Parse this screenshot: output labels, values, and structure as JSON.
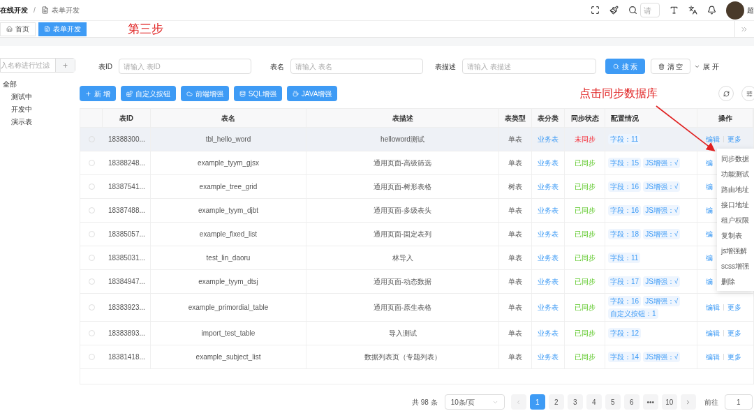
{
  "breadcrumb": [
    {
      "label": "在线开发"
    },
    {
      "label": "表单开发"
    }
  ],
  "breadcrumb_separator": "/",
  "header": {
    "search_placeholder": "请",
    "user_name": "超"
  },
  "tabs": [
    {
      "label": "首页",
      "selected": false
    },
    {
      "label": "表单开发",
      "selected": true
    }
  ],
  "annotations": {
    "step": "第三步",
    "hint": "点击同步数据库"
  },
  "sidebar": {
    "filter_placeholder": "入名称进行过滤",
    "add": "+",
    "tree": [
      {
        "label": "全部",
        "children": [
          {
            "label": "测试中"
          },
          {
            "label": "开发中"
          },
          {
            "label": "演示表"
          }
        ]
      }
    ]
  },
  "filters": [
    {
      "label": "表ID",
      "placeholder": "请输入 表ID"
    },
    {
      "label": "表名",
      "placeholder": "请输入 表名"
    },
    {
      "label": "表描述",
      "placeholder": "请输入 表描述"
    }
  ],
  "search_button": "搜 索",
  "clear_button": "清 空",
  "expand_link": "展 开",
  "toolbar": [
    {
      "label": "新 增"
    },
    {
      "label": "自定义按钮"
    },
    {
      "label": "前端增强"
    },
    {
      "label": "SQL增强"
    },
    {
      "label": "JAVA增强"
    }
  ],
  "table": {
    "columns": [
      "表ID",
      "表名",
      "表描述",
      "表类型",
      "表分类",
      "同步状态",
      "配置情况",
      "操作"
    ],
    "rows": [
      {
        "selected": false,
        "hover": true,
        "id": "18388300...",
        "name": "tbl_hello_word",
        "desc": "helloword测试",
        "type": "单表",
        "category": "业务表",
        "sync": "未同步",
        "synced": false,
        "tags": [
          "字段：11"
        ],
        "edit": "编辑",
        "more": "更多"
      },
      {
        "selected": false,
        "hover": false,
        "id": "18388248...",
        "name": "example_tyym_gjsx",
        "desc": "通用页面-高级筛选",
        "type": "单表",
        "category": "业务表",
        "sync": "已同步",
        "synced": true,
        "tags": [
          "字段：15",
          "JS增强：√"
        ],
        "edit": "编"
      },
      {
        "selected": false,
        "hover": false,
        "id": "18387541...",
        "name": "example_tree_grid",
        "desc": "通用页面-树形表格",
        "type": "树表",
        "category": "业务表",
        "sync": "已同步",
        "synced": true,
        "tags": [
          "字段：16",
          "JS增强：√"
        ],
        "edit": "编"
      },
      {
        "selected": false,
        "hover": false,
        "id": "18387488...",
        "name": "example_tyym_djbt",
        "desc": "通用页面-多级表头",
        "type": "单表",
        "category": "业务表",
        "sync": "已同步",
        "synced": true,
        "tags": [
          "字段：16",
          "JS增强：√"
        ],
        "edit": "编"
      },
      {
        "selected": false,
        "hover": false,
        "id": "18385057...",
        "name": "example_fixed_list",
        "desc": "通用页面-固定表列",
        "type": "单表",
        "category": "业务表",
        "sync": "已同步",
        "synced": true,
        "tags": [
          "字段：18",
          "JS增强：√"
        ],
        "edit": "编"
      },
      {
        "selected": false,
        "hover": false,
        "id": "18385031...",
        "name": "test_lin_daoru",
        "desc": "林导入",
        "type": "单表",
        "category": "业务表",
        "sync": "已同步",
        "synced": true,
        "tags": [
          "字段：11"
        ],
        "edit": "编"
      },
      {
        "selected": false,
        "hover": false,
        "id": "18384947...",
        "name": "example_tyym_dtsj",
        "desc": "通用页面-动态数据",
        "type": "单表",
        "category": "业务表",
        "sync": "已同步",
        "synced": true,
        "tags": [
          "字段：17",
          "JS增强：√"
        ],
        "edit": "编"
      },
      {
        "selected": false,
        "hover": false,
        "id": "18383923...",
        "name": "example_primordial_table",
        "desc": "通用页面-原生表格",
        "type": "单表",
        "category": "业务表",
        "sync": "已同步",
        "synced": true,
        "tags": [
          "字段：16",
          "JS增强：√",
          "自定义按钮：1"
        ],
        "edit": "编辑",
        "more": "更多"
      },
      {
        "selected": false,
        "hover": false,
        "id": "18383893...",
        "name": "import_test_table",
        "desc": "导入测试",
        "type": "单表",
        "category": "业务表",
        "sync": "已同步",
        "synced": true,
        "tags": [
          "字段：12"
        ],
        "edit": "编辑",
        "more": "更多"
      },
      {
        "selected": false,
        "hover": false,
        "id": "18381418...",
        "name": "example_subject_list",
        "desc": "数据列表页（专题列表）",
        "type": "单表",
        "category": "业务表",
        "sync": "已同步",
        "synced": true,
        "tags": [
          "字段：14",
          "JS增强：√"
        ],
        "edit": "编辑",
        "more": "更多"
      }
    ]
  },
  "dropdown_menu": [
    "同步数据",
    "功能测试",
    "路由地址",
    "接口地址",
    "租户权限",
    "复制表",
    "js增强解",
    "scss增强",
    "删除"
  ],
  "pagination": {
    "total": "共 98 条",
    "page_size": "10条/页",
    "pages": [
      {
        "label": "1",
        "selected": true
      },
      {
        "label": "2",
        "selected": false
      },
      {
        "label": "3",
        "selected": false
      },
      {
        "label": "4",
        "selected": false
      },
      {
        "label": "5",
        "selected": false
      },
      {
        "label": "6",
        "selected": false
      },
      {
        "label": "•••",
        "selected": false
      },
      {
        "label": "10",
        "selected": false
      }
    ],
    "goto_label": "前往",
    "goto_value": "1"
  }
}
